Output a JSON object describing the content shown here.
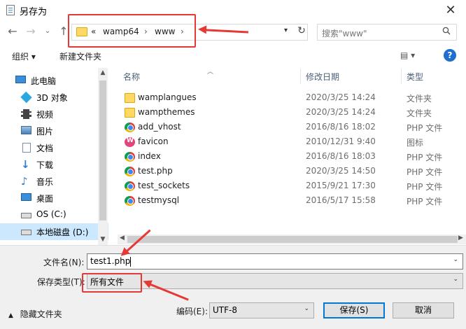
{
  "window": {
    "title": "另存为",
    "close_glyph": "✕"
  },
  "nav": {
    "back_glyph": "←",
    "forward_glyph": "→",
    "dropdown_glyph": "⌄",
    "up_glyph": "↑",
    "breadcrumb_prefix": "«",
    "breadcrumb": [
      "wamp64",
      "www"
    ],
    "breadcrumb_sep": "›",
    "refresh_glyph": "↻",
    "search_placeholder": "搜索\"www\""
  },
  "toolbar": {
    "organize": "组织 ▾",
    "new_folder": "新建文件夹",
    "view_glyph": "▤ ▾",
    "help": "?"
  },
  "sidebar": {
    "items": [
      {
        "label": "此电脑",
        "icon": "computer-icon",
        "color": "#3a8fd8"
      },
      {
        "label": "3D 对象",
        "icon": "cube-3d-icon",
        "color": "#29a8e0"
      },
      {
        "label": "视频",
        "icon": "film-icon",
        "color": "#444444"
      },
      {
        "label": "图片",
        "icon": "picture-icon",
        "color": "#4a7fb8"
      },
      {
        "label": "文档",
        "icon": "document-icon",
        "color": "#7a8fa6"
      },
      {
        "label": "下载",
        "icon": "download-icon",
        "color": "#2f7fd3"
      },
      {
        "label": "音乐",
        "icon": "music-icon",
        "color": "#2f7fd3"
      },
      {
        "label": "桌面",
        "icon": "desktop-icon",
        "color": "#3a8fd8"
      },
      {
        "label": "OS (C:)",
        "icon": "drive-c-icon",
        "color": "#666666"
      },
      {
        "label": "本地磁盘 (D:)",
        "icon": "drive-d-icon",
        "color": "#666666"
      }
    ]
  },
  "columns": {
    "name": "名称",
    "date": "修改日期",
    "type": "类型"
  },
  "files": [
    {
      "name": "wamplangues",
      "date": "2020/3/25 14:24",
      "type": "文件夹",
      "icon": "folder-icon"
    },
    {
      "name": "wampthemes",
      "date": "2020/3/25 14:24",
      "type": "文件夹",
      "icon": "folder-icon"
    },
    {
      "name": "add_vhost",
      "date": "2016/8/16 18:02",
      "type": "PHP 文件",
      "icon": "chrome-file-icon"
    },
    {
      "name": "favicon",
      "date": "2010/12/31 9:40",
      "type": "图标",
      "icon": "wamp-icon"
    },
    {
      "name": "index",
      "date": "2016/8/16 18:03",
      "type": "PHP 文件",
      "icon": "chrome-file-icon"
    },
    {
      "name": "test.php",
      "date": "2020/3/25 14:50",
      "type": "PHP 文件",
      "icon": "chrome-file-icon"
    },
    {
      "name": "test_sockets",
      "date": "2015/9/21 17:30",
      "type": "PHP 文件",
      "icon": "chrome-file-icon"
    },
    {
      "name": "testmysql",
      "date": "2016/5/17 15:58",
      "type": "PHP 文件",
      "icon": "chrome-file-icon"
    }
  ],
  "form": {
    "filename_label": "文件名(N):",
    "filename_value": "test1.php",
    "type_label": "保存类型(T):",
    "type_value": "所有文件",
    "encoding_label": "编码(E):",
    "encoding_value": "UTF-8",
    "save": "保存(S)",
    "cancel": "取消",
    "hide_folders": "隐藏文件夹"
  },
  "colors": {
    "annotation": "#e53935",
    "selection": "#cce8ff",
    "accent": "#0078d7"
  }
}
